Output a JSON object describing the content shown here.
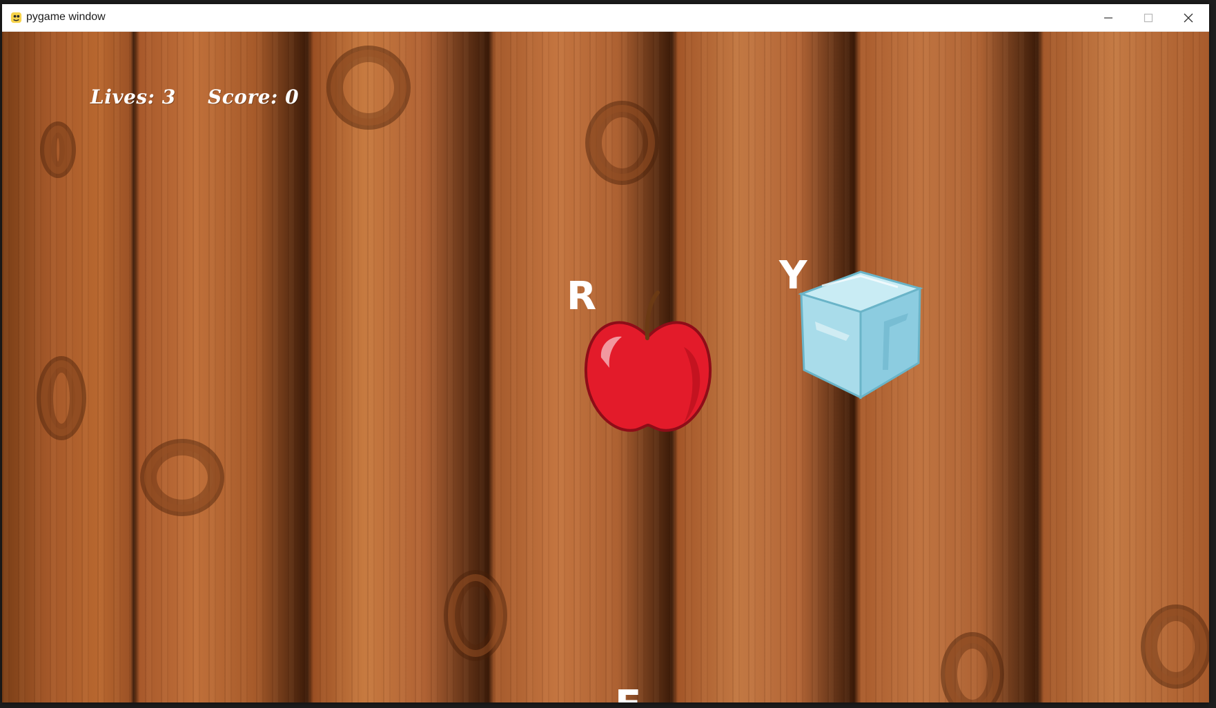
{
  "window": {
    "title": "pygame window",
    "app_icon": "python-snake-icon",
    "controls": {
      "minimize_icon": "minimize-icon",
      "maximize_icon": "maximize-icon",
      "close_icon": "close-icon"
    }
  },
  "hud": {
    "lives_label": "Lives: 3",
    "score_label": "Score: 0",
    "lives": 3,
    "score": 0
  },
  "objects": [
    {
      "kind": "apple",
      "key": "R",
      "icon": "apple-icon"
    },
    {
      "kind": "ice-cube",
      "key": "Y",
      "icon": "ice-cube-icon"
    },
    {
      "kind": "unknown",
      "key": "E"
    }
  ],
  "colors": {
    "wood": "#b0622f",
    "apple_red": "#e31b2a",
    "ice_blue": "#9dd6e6",
    "text": "#ffffff"
  }
}
